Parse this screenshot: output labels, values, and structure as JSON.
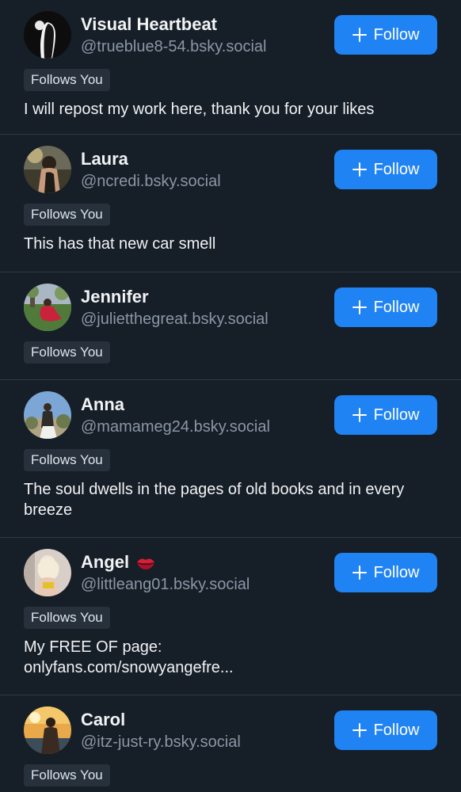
{
  "users": [
    {
      "avatar_icon": "avatar-visual-heartbeat",
      "name": "Visual Heartbeat",
      "handle": "@trueblue8-54.bsky.social",
      "follow_label": "Follow",
      "badge": "Follows You",
      "bio": "I will repost my work here, thank you for your likes"
    },
    {
      "avatar_icon": "avatar-laura",
      "name": "Laura",
      "handle": "@ncredi.bsky.social",
      "follow_label": "Follow",
      "badge": "Follows You",
      "bio": "This has that new car smell"
    },
    {
      "avatar_icon": "avatar-jennifer",
      "name": "Jennifer",
      "handle": "@julietthegreat.bsky.social",
      "follow_label": "Follow",
      "badge": "Follows You",
      "bio": ""
    },
    {
      "avatar_icon": "avatar-anna",
      "name": "Anna",
      "handle": "@mamameg24.bsky.social",
      "follow_label": "Follow",
      "badge": "Follows You",
      "bio": "The soul dwells in the pages of old books and in every breeze"
    },
    {
      "avatar_icon": "avatar-angel",
      "name": "Angel",
      "name_emoji_icon": "kiss-mark-icon",
      "handle": "@littleang01.bsky.social",
      "follow_label": "Follow",
      "badge": "Follows You",
      "bio_line1": "My FREE OF page:",
      "bio_line2": "onlyfans.com/snowyangefre..."
    },
    {
      "avatar_icon": "avatar-carol",
      "name": "Carol",
      "handle": "@itz-just-ry.bsky.social",
      "follow_label": "Follow",
      "badge": "Follows You"
    }
  ],
  "colors": {
    "background": "#161e27",
    "accent": "#2083f3",
    "handle_text": "#8a97a6",
    "badge_bg": "#27313c",
    "divider": "#2e3a47"
  }
}
